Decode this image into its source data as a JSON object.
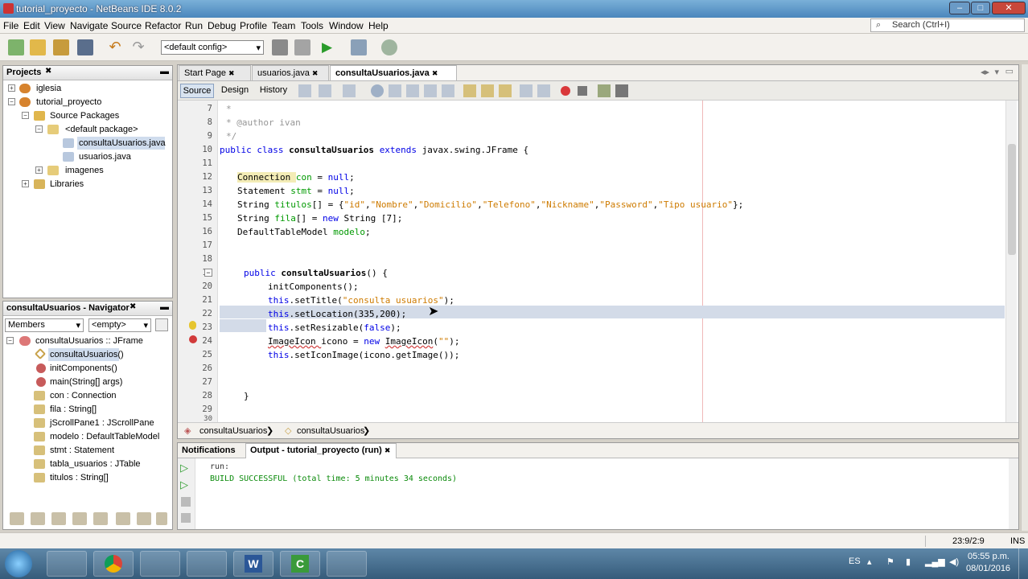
{
  "window": {
    "title": "tutorial_proyecto - NetBeans IDE 8.0.2"
  },
  "menu": [
    "File",
    "Edit",
    "View",
    "Navigate",
    "Source",
    "Refactor",
    "Run",
    "Debug",
    "Profile",
    "Team",
    "Tools",
    "Window",
    "Help"
  ],
  "search": {
    "placeholder": "Search (Ctrl+I)"
  },
  "toolbar": {
    "config": "<default config>"
  },
  "projects": {
    "title": "Projects",
    "items": [
      "iglesia",
      "tutorial_proyecto",
      "Source Packages",
      "<default package>",
      "consultaUsuarios.java",
      "usuarios.java",
      "imagenes",
      "Libraries"
    ]
  },
  "navigator": {
    "title": "consultaUsuarios - Navigator",
    "members": "Members",
    "filter": "<empty>",
    "items": [
      "consultaUsuarios :: JFrame",
      "consultaUsuarios()",
      "initComponents()",
      "main(String[] args)",
      "con : Connection",
      "fila : String[]",
      "jScrollPane1 : JScrollPane",
      "modelo : DefaultTableModel",
      "stmt : Statement",
      "tabla_usuarios : JTable",
      "titulos : String[]"
    ]
  },
  "editor": {
    "tabs": [
      "Start Page",
      "usuarios.java",
      "consultaUsuarios.java"
    ],
    "subtabs": [
      "Source",
      "Design",
      "History"
    ],
    "line_numbers": [
      "7",
      "8",
      "9",
      "10",
      "11",
      "12",
      "13",
      "14",
      "15",
      "16",
      "17",
      "18",
      "19",
      "20",
      "21",
      "22",
      "23",
      "24",
      "25",
      "26",
      "27",
      "28",
      "29",
      "30"
    ],
    "breadcrumb": [
      "consultaUsuarios",
      "consultaUsuarios"
    ]
  },
  "code": {
    "l7": "*",
    "l8": "* @author ivan",
    "l9": "*/",
    "l10_a": "public class ",
    "l10_b": "consultaUsuarios ",
    "l10_c": "extends ",
    "l10_d": "javax.swing.JFrame {",
    "l12_a": "Connection ",
    "l12_b": "con ",
    "l12_c": "= ",
    "l12_d": "null",
    "l12_e": ";",
    "l13_a": "Statement ",
    "l13_b": "stmt ",
    "l13_c": "= ",
    "l13_d": "null",
    "l13_e": ";",
    "l14_a": "String ",
    "l14_b": "titulos",
    "l14_c": "[] = {",
    "l14_d": "\"id\"",
    "l14_e": ",",
    "l14_f": "\"Nombre\"",
    "l14_g": ",",
    "l14_h": "\"Domicilio\"",
    "l14_i": ",",
    "l14_j": "\"Telefono\"",
    "l14_k": ",",
    "l14_l": "\"Nickname\"",
    "l14_m": ",",
    "l14_n": "\"Password\"",
    "l14_o": ",",
    "l14_p": "\"Tipo usuario\"",
    "l14_q": "};",
    "l15_a": "String ",
    "l15_b": "fila",
    "l15_c": "[] = ",
    "l15_d": "new ",
    "l15_e": "String [7];",
    "l16_a": "DefaultTableModel ",
    "l16_b": "modelo",
    "l16_c": ";",
    "l19_a": "public ",
    "l19_b": "consultaUsuarios",
    "l19_c": "() {",
    "l20": "initComponents();",
    "l21_a": "this",
    "l21_b": ".setTitle(",
    "l21_c": "\"consulta usuarios\"",
    "l21_d": ");",
    "l22_a": "this",
    "l22_b": ".setLocation(335,200);",
    "l23_a": "this",
    "l23_b": ".setResizable(",
    "l23_c": "false",
    "l23_d": ");",
    "l24_a": "ImageIcon ",
    "l24_b": "icono = ",
    "l24_c": "new ",
    "l24_d": "ImageIcon",
    "l24_e": "(",
    "l24_f": "\"\"",
    "l24_g": ");",
    "l25_a": "this",
    "l25_b": ".setIconImage(icono.getImage());",
    "l28": "}"
  },
  "output": {
    "tabs": [
      "Notifications",
      "Output - tutorial_proyecto (run)"
    ],
    "lines": [
      "run:",
      "BUILD SUCCESSFUL (total time: 5 minutes 34 seconds)"
    ]
  },
  "status": {
    "position": "23:9/2:9",
    "mode": "INS"
  },
  "taskbar": {
    "lang": "ES",
    "time": "05:55 p.m.",
    "date": "08/01/2016"
  }
}
